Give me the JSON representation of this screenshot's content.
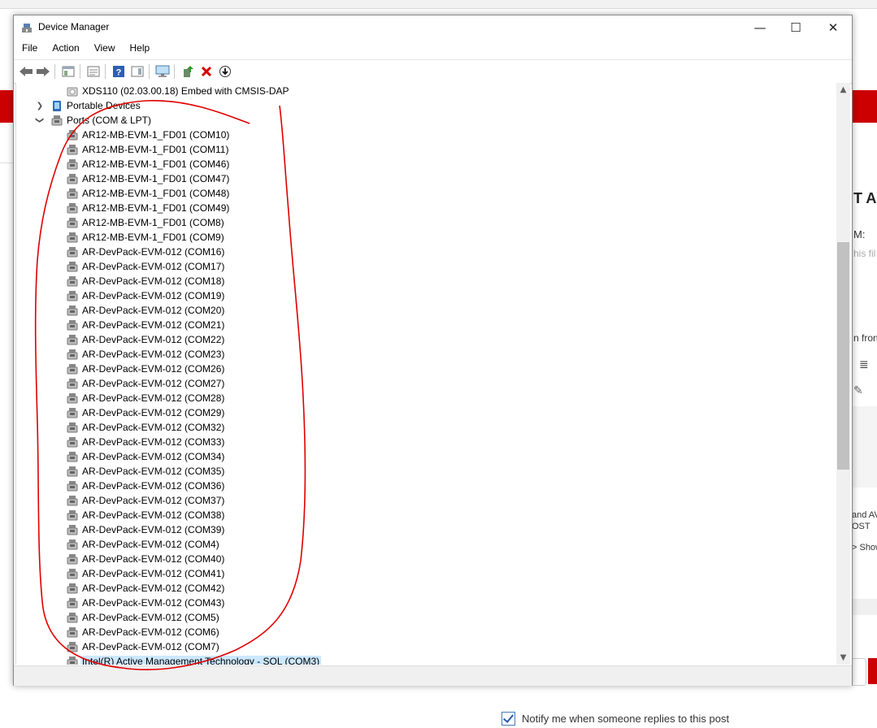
{
  "window": {
    "title": "Device Manager",
    "controls": {
      "minimize": "—",
      "maximize": "☐",
      "close": "✕"
    }
  },
  "menu": [
    "File",
    "Action",
    "View",
    "Help"
  ],
  "toolbar_icons": [
    "back-arrow-icon",
    "forward-arrow-icon",
    "show-hide-console-tree-icon",
    "properties-icon",
    "help-icon",
    "action-pane-icon",
    "computer-monitor-icon",
    "update-driver-icon",
    "uninstall-red-x-icon",
    "download-circle-icon"
  ],
  "tree": {
    "xds_item": "XDS110 (02.03.00.18) Embed with CMSIS-DAP",
    "portable_devices": "Portable Devices",
    "ports_category": "Ports (COM & LPT)",
    "ports": [
      "AR12-MB-EVM-1_FD01 (COM10)",
      "AR12-MB-EVM-1_FD01 (COM11)",
      "AR12-MB-EVM-1_FD01 (COM46)",
      "AR12-MB-EVM-1_FD01 (COM47)",
      "AR12-MB-EVM-1_FD01 (COM48)",
      "AR12-MB-EVM-1_FD01 (COM49)",
      "AR12-MB-EVM-1_FD01 (COM8)",
      "AR12-MB-EVM-1_FD01 (COM9)",
      "AR-DevPack-EVM-012 (COM16)",
      "AR-DevPack-EVM-012 (COM17)",
      "AR-DevPack-EVM-012 (COM18)",
      "AR-DevPack-EVM-012 (COM19)",
      "AR-DevPack-EVM-012 (COM20)",
      "AR-DevPack-EVM-012 (COM21)",
      "AR-DevPack-EVM-012 (COM22)",
      "AR-DevPack-EVM-012 (COM23)",
      "AR-DevPack-EVM-012 (COM26)",
      "AR-DevPack-EVM-012 (COM27)",
      "AR-DevPack-EVM-012 (COM28)",
      "AR-DevPack-EVM-012 (COM29)",
      "AR-DevPack-EVM-012 (COM32)",
      "AR-DevPack-EVM-012 (COM33)",
      "AR-DevPack-EVM-012 (COM34)",
      "AR-DevPack-EVM-012 (COM35)",
      "AR-DevPack-EVM-012 (COM36)",
      "AR-DevPack-EVM-012 (COM37)",
      "AR-DevPack-EVM-012 (COM38)",
      "AR-DevPack-EVM-012 (COM39)",
      "AR-DevPack-EVM-012 (COM4)",
      "AR-DevPack-EVM-012 (COM40)",
      "AR-DevPack-EVM-012 (COM41)",
      "AR-DevPack-EVM-012 (COM42)",
      "AR-DevPack-EVM-012 (COM43)",
      "AR-DevPack-EVM-012 (COM5)",
      "AR-DevPack-EVM-012 (COM6)",
      "AR-DevPack-EVM-012 (COM7)"
    ],
    "selected_item": "Intel(R) Active Management Technology - SOL (COM3)"
  },
  "background": {
    "heading_fragment": "T A",
    "m_fragment": "M:",
    "this_fragment": "his fil",
    "from_fragment": "n fron",
    "and_fragment": "and AV",
    "post_fragment": "OST",
    "show_fragment": "> Show",
    "notify_label": "Notify me when someone replies to this post"
  },
  "colors": {
    "annotation_red": "#e00000",
    "selection_blue": "#cce8ff",
    "brand_red": "#cc0000"
  }
}
